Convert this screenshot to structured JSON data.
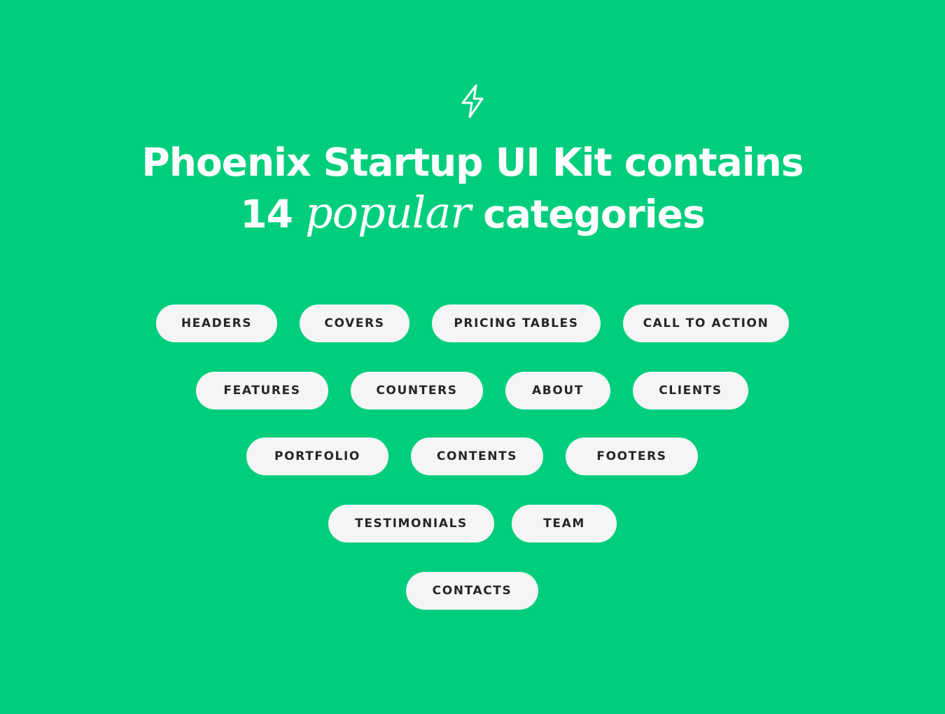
{
  "icon": "lightning-bolt-icon",
  "colors": {
    "background": "#00CE7C",
    "pill": "#F5F5F5",
    "pill_text": "#262626",
    "title": "#FFFFFF"
  },
  "heading": {
    "line1": "Phoenix Startup UI Kit contains",
    "line2_prefix": "14 ",
    "line2_italic": "popular",
    "line2_suffix": " categories"
  },
  "categories": [
    "HEADERS",
    "COVERS",
    "PRICING TABLES",
    "CALL TO ACTION",
    "FEATURES",
    "COUNTERS",
    "ABOUT",
    "CLIENTS",
    "PORTFOLIO",
    "CONTENTS",
    "FOOTERS",
    "TESTIMONIALS",
    "TEAM",
    "CONTACTS"
  ]
}
